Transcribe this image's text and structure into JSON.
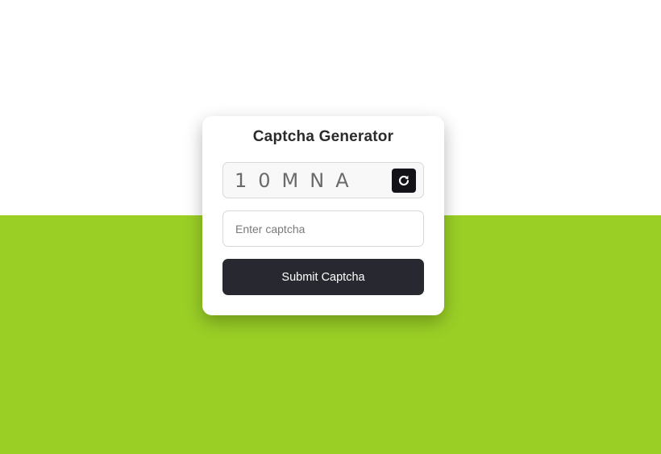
{
  "card": {
    "title": "Captcha Generator",
    "captcha_code": "10MNA",
    "refresh_icon": "refresh-icon",
    "input_placeholder": "Enter captcha",
    "input_value": "",
    "submit_label": "Submit Captcha"
  },
  "colors": {
    "top_background": "#ffffff",
    "bottom_background": "#9acf26",
    "card_background": "#ffffff",
    "refresh_button": "#121218",
    "submit_button": "#282830",
    "submit_text": "#ffffff"
  }
}
